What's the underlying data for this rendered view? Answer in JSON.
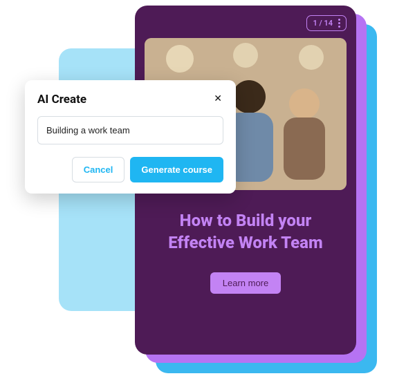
{
  "course": {
    "pageIndicator": "1 / 14",
    "title": "How to Build your Effective Work Team",
    "learnMoreLabel": "Learn more"
  },
  "dialog": {
    "title": "AI Create",
    "inputValue": "Building a work team",
    "cancelLabel": "Cancel",
    "generateLabel": "Generate course"
  }
}
